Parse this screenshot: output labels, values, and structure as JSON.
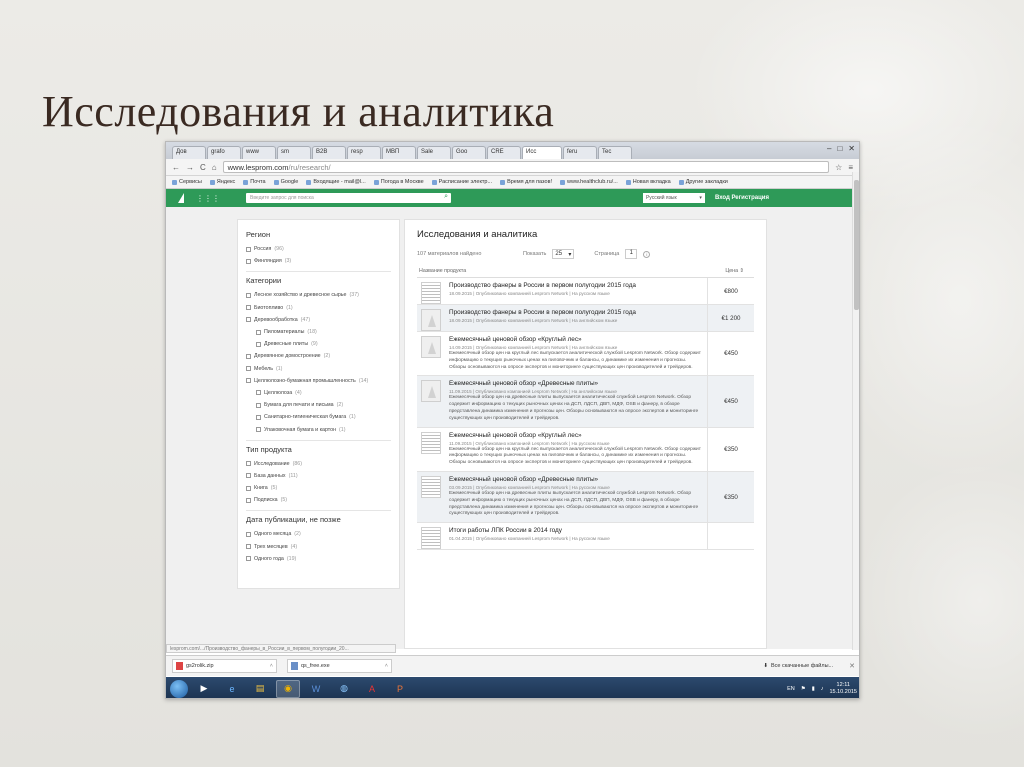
{
  "slide": {
    "title": "Исследования и аналитика"
  },
  "browser": {
    "tabs": [
      "Дов",
      "grafo",
      "www",
      "sm",
      "B2B",
      "resp",
      "МВП",
      "Sale",
      "Goo",
      "CRE",
      "Исс",
      "feru",
      "Tec"
    ],
    "address": {
      "host": "www.lesprom.com",
      "path": "/ru/research/"
    },
    "bookmarks": [
      "Сервисы",
      "Яндекс",
      "Почта",
      "Google",
      "Входящие - mail@l...",
      "Погода в Москве",
      "Расписание электр...",
      "Время для пазов!",
      "www.healthclub.ru/...",
      "Новая вкладка",
      "Другие закладки"
    ]
  },
  "site": {
    "search_placeholder": "Введите запрос для поиска",
    "language": "Русский язык",
    "login": "Вход",
    "register": "Регистрация"
  },
  "sidebar": {
    "region": {
      "heading": "Регион",
      "items": [
        {
          "label": "Россия",
          "count": "(96)"
        },
        {
          "label": "Финляндия",
          "count": "(3)"
        }
      ]
    },
    "categories": {
      "heading": "Категории",
      "items": [
        {
          "label": "Лесное хозяйство и древесное сырье",
          "count": "(37)",
          "sub": false
        },
        {
          "label": "Биотопливо",
          "count": "(1)",
          "sub": false
        },
        {
          "label": "Деревообработка",
          "count": "(47)",
          "sub": false
        },
        {
          "label": "Пиломатериалы",
          "count": "(18)",
          "sub": true
        },
        {
          "label": "Древесные плиты",
          "count": "(9)",
          "sub": true
        },
        {
          "label": "Деревянное домостроение",
          "count": "(2)",
          "sub": false
        },
        {
          "label": "Мебель",
          "count": "(1)",
          "sub": false
        },
        {
          "label": "Целлюлозно-бумажная промышленность",
          "count": "(14)",
          "sub": false
        },
        {
          "label": "Целлюлоза",
          "count": "(4)",
          "sub": true
        },
        {
          "label": "Бумага для печати и письма",
          "count": "(2)",
          "sub": true
        },
        {
          "label": "Санитарно-гигиеническая бумага",
          "count": "(1)",
          "sub": true
        },
        {
          "label": "Упаковочная бумага и картон",
          "count": "(1)",
          "sub": true
        }
      ]
    },
    "product_type": {
      "heading": "Тип продукта",
      "items": [
        {
          "label": "Исследование",
          "count": "(86)"
        },
        {
          "label": "База данных",
          "count": "(11)"
        },
        {
          "label": "Книга",
          "count": "(5)"
        },
        {
          "label": "Подписка",
          "count": "(5)"
        }
      ]
    },
    "publish_date": {
      "heading": "Дата публикации, не позже",
      "items": [
        {
          "label": "Одного месяца",
          "count": "(2)"
        },
        {
          "label": "Трех месяцев",
          "count": "(4)"
        },
        {
          "label": "Одного года",
          "count": "(19)"
        }
      ]
    }
  },
  "main": {
    "title": "Исследования и аналитика",
    "found": "107 материалов найдено",
    "show_label": "Показать",
    "per_page": "25",
    "page_label": "Страница",
    "page": "1",
    "col_name": "Название продукта",
    "col_price": "Цена",
    "rows": [
      {
        "title": "Производство фанеры в России в первом полугодии 2015 года",
        "meta": "18.09.2015 | Опубликовано компанией Lesprom Network | На русском языке",
        "desc": "",
        "price": "€800",
        "thumb": "doc",
        "alt": false
      },
      {
        "title": "Производство фанеры в России в первом полугодии 2015 года",
        "meta": "18.09.2015 | Опубликовано компанией Lesprom Network | На английском языке",
        "desc": "",
        "price": "€1 200",
        "thumb": "logo",
        "alt": true
      },
      {
        "title": "Ежемесячный ценовой обзор «Круглый лес»",
        "meta": "14.09.2015 | Опубликовано компанией Lesprom Network | На английском языке",
        "desc": "Ежемесячный обзор цен на круглый лес выпускается аналитической службой Lesprom Network. Обзор содержит информацию о текущих рыночных ценах на пиловочник и балансы, о динамике их изменения и прогнозы. Обзоры основываются на опросе экспертов и мониторинге существующих цен производителей и трейдеров.",
        "price": "€450",
        "thumb": "logo",
        "alt": false
      },
      {
        "title": "Ежемесячный ценовой обзор «Древесные плиты»",
        "meta": "11.09.2015 | Опубликовано компанией Lesprom Network | На английском языке",
        "desc": "Ежемесячный обзор цен на древесные плиты выпускается аналитической службой Lesprom Network. Обзор содержит информацию о текущих рыночных ценах на ДСП, ЛДСП, ДВП, МДФ, OSB и фанеру, в обзоре представлена динамика изменения и прогнозы цен. Обзоры основываются на опросе экспертов и мониторинге существующих цен производителей и трейдеров.",
        "price": "€450",
        "thumb": "logo",
        "alt": true
      },
      {
        "title": "Ежемесячный ценовой обзор «Круглый лес»",
        "meta": "11.09.2015 | Опубликовано компанией Lesprom Network | На русском языке",
        "desc": "Ежемесячный обзор цен на круглый лес выпускается аналитической службой Lesprom Network. Обзор содержит информацию о текущих рыночных ценах на пиловочник и балансы, о динамике их изменения и прогнозы. Обзоры основываются на опросе экспертов и мониторинге существующих цен производителей и трейдеров.",
        "price": "€350",
        "thumb": "doc",
        "alt": false
      },
      {
        "title": "Ежемесячный ценовой обзор «Древесные плиты»",
        "meta": "03.09.2015 | Опубликовано компанией Lesprom Network | На русском языке",
        "desc": "Ежемесячный обзор цен на древесные плиты выпускается аналитической службой Lesprom Network. Обзор содержит информацию о текущих рыночных ценах на ДСП, ЛДСП, ДВП, МДФ, OSB и фанеру, в обзоре представлена динамика изменения и прогнозы цен. Обзоры основываются на опросе экспертов и мониторинге существующих цен производителей и трейдеров.",
        "price": "€350",
        "thumb": "doc",
        "alt": true
      },
      {
        "title": "Итоги работы ЛПК России в 2014 году",
        "meta": "01.04.2015 | Опубликовано компанией Lesprom Network | На русском языке",
        "desc": "",
        "price": "",
        "thumb": "doc",
        "alt": false
      }
    ]
  },
  "statusbar": {
    "text": "lesprom.com/.../Производство_фанеры_в_России_в_первом_полугодии_20..."
  },
  "downloads": {
    "items": [
      "gs2rolik.zip",
      "qs_free.exe"
    ],
    "show_all": "Все скачанные файлы..."
  },
  "taskbar": {
    "lang": "EN",
    "time": "12:11",
    "date": "15.10.2015"
  }
}
